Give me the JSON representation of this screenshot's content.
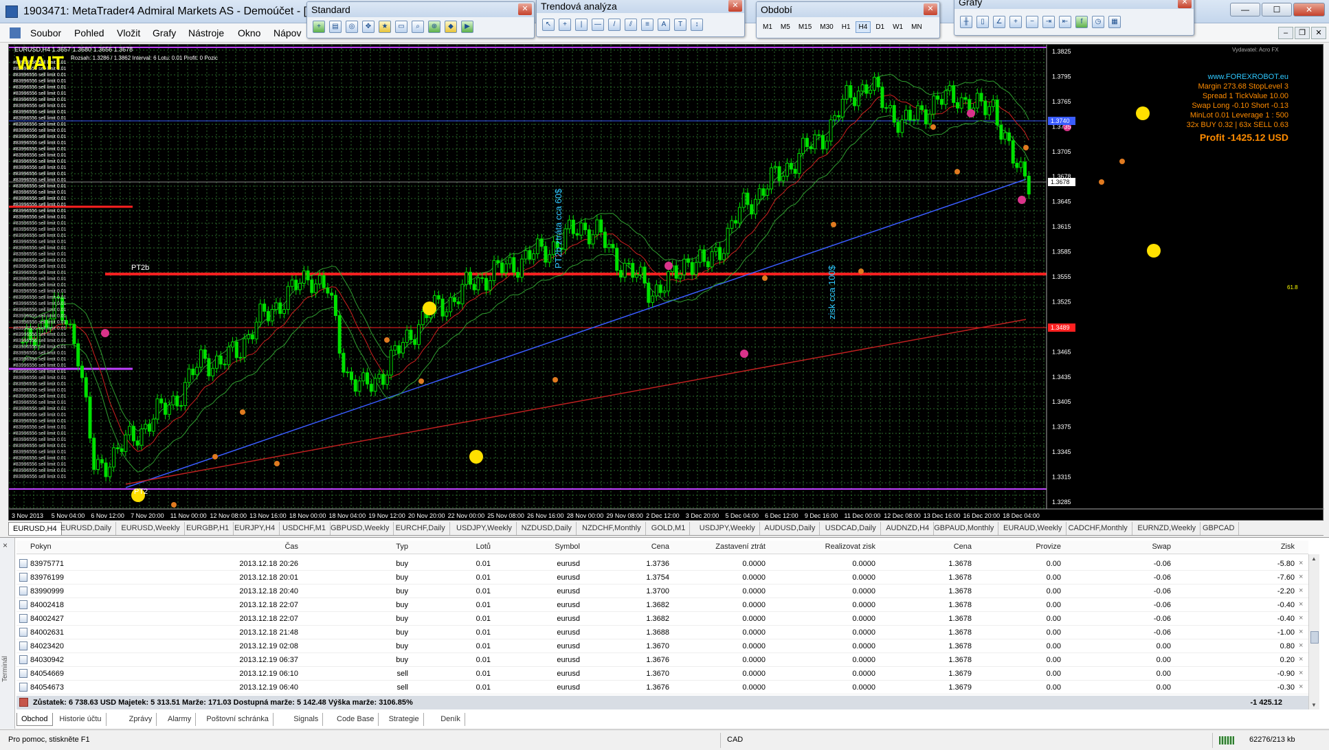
{
  "window": {
    "title": "1903471: MetaTrader4 Admiral Markets AS - Demoúčet - [EUR",
    "minimize": "—",
    "maximize": "☐",
    "close": "✕"
  },
  "menu": {
    "items": [
      "Soubor",
      "Pohled",
      "Vložit",
      "Grafy",
      "Nástroje",
      "Okno",
      "Nápov"
    ]
  },
  "toolbars": {
    "standard": {
      "title": "Standard"
    },
    "trend": {
      "title": "Trendová analýza"
    },
    "period": {
      "title": "Období",
      "buttons": [
        "M1",
        "M5",
        "M15",
        "M30",
        "H1",
        "H4",
        "D1",
        "W1",
        "MN"
      ],
      "active": "H4"
    },
    "charts": {
      "title": "Grafy"
    }
  },
  "chart": {
    "header": "EURUSD,H4  1.3657 1.3680 1.3656 1.3678",
    "wait_label": "WAIT",
    "range_info": "Rozsah: 1.3286 / 1.3862  Interval: 6  Lotu: 0.01  Profit: 0  Pozic",
    "top_right_label": "Vydavatel: Acro FX",
    "pt2b_label": "PT2b",
    "pt2_label": "PT2",
    "vertical_note_1": "PT2b  ztráta cca 60$",
    "vertical_note_2": "zisk cca 100$",
    "info_lines": [
      "www.FOREXROBOT.eu",
      "Margin 273.68  StopLevel 3",
      "Spread 1  TickValue 10.00",
      "Swap Long -0.10 Short -0.13",
      "MinLot 0.01  Leverage 1 : 500",
      "32x BUY 0.32 | 63x SELL 0.63"
    ],
    "profit_text": "Profit -1425.12 USD",
    "orders_text": "#83996556 sell limit 0.01",
    "price_labels": [
      "1.3825",
      "1.3795",
      "1.3765",
      "1.3735",
      "1.3705",
      "1.3678",
      "1.3645",
      "1.3615",
      "1.3585",
      "1.3555",
      "1.3525",
      "1.3495",
      "1.3465",
      "1.3435",
      "1.3405",
      "1.3375",
      "1.3345",
      "1.3315",
      "1.3285"
    ],
    "current_price": "1.3678",
    "blue_line_price": "1.3740",
    "red_line_price": "1.3489",
    "level_marker": "61.8",
    "time_labels": [
      "3 Nov 2013",
      "5 Nov 04:00",
      "6 Nov 12:00",
      "7 Nov 20:00",
      "11 Nov 00:00",
      "12 Nov 08:00",
      "13 Nov 16:00",
      "18 Nov 00:00",
      "18 Nov 04:00",
      "19 Nov 12:00",
      "20 Nov 20:00",
      "22 Nov 00:00",
      "25 Nov 08:00",
      "26 Nov 16:00",
      "28 Nov 00:00",
      "29 Nov 08:00",
      "2 Dec 12:00",
      "3 Dec 20:00",
      "5 Dec 04:00",
      "6 Dec 12:00",
      "9 Dec 16:00",
      "11 Dec 00:00",
      "12 Dec 08:00",
      "13 Dec 16:00",
      "16 Dec 20:00",
      "18 Dec 04:00"
    ],
    "colors": {
      "background": "#000000",
      "grid": "#2c6b2c",
      "candle": "#00e000",
      "red": "#ff2020",
      "blue": "#3a5cff",
      "purple": "#c040ff"
    }
  },
  "chart_data": {
    "type": "candlestick",
    "symbol": "EURUSD",
    "timeframe": "H4",
    "ylim": [
      1.3275,
      1.3835
    ],
    "close_path": [
      1.347,
      1.35,
      1.352,
      1.348,
      1.332,
      1.334,
      1.336,
      1.338,
      1.34,
      1.342,
      1.346,
      1.345,
      1.347,
      1.35,
      1.352,
      1.354,
      1.356,
      1.354,
      1.344,
      1.342,
      1.344,
      1.347,
      1.35,
      1.352,
      1.353,
      1.355,
      1.356,
      1.357,
      1.358,
      1.359,
      1.36,
      1.362,
      1.361,
      1.358,
      1.356,
      1.354,
      1.355,
      1.358,
      1.357,
      1.36,
      1.364,
      1.366,
      1.368,
      1.37,
      1.372,
      1.374,
      1.378,
      1.379,
      1.377,
      1.374,
      1.376,
      1.377,
      1.378,
      1.376,
      1.377,
      1.37,
      1.3678
    ]
  },
  "symbol_tabs": [
    "EURUSD,H4",
    "EURUSD,Daily",
    "EURUSD,Weekly",
    "EURGBP,H1",
    "EURJPY,H4",
    "USDCHF,M1",
    "GBPUSD,Weekly",
    "EURCHF,Daily",
    "USDJPY,Weekly",
    "NZDUSD,Daily",
    "NZDCHF,Monthly",
    "GOLD,M1",
    "USDJPY,Weekly",
    "AUDUSD,Daily",
    "USDCAD,Daily",
    "AUDNZD,H4",
    "GBPAUD,Monthly",
    "EURAUD,Weekly",
    "CADCHF,Monthly",
    "EURNZD,Weekly",
    "GBPCAD"
  ],
  "terminal": {
    "side_label": "Terminál",
    "side_close": "×",
    "columns": [
      "Pokyn",
      "Čas",
      "Typ",
      "Lotů",
      "Symbol",
      "Cena",
      "Zastavení ztrát",
      "Realizovat zisk",
      "Cena",
      "Provize",
      "Swap",
      "Zisk"
    ],
    "rows": [
      {
        "id": "83975771",
        "time": "2013.12.18 20:26",
        "type": "buy",
        "lots": "0.01",
        "symbol": "eurusd",
        "price": "1.3736",
        "sl": "0.0000",
        "tp": "0.0000",
        "cur": "1.3678",
        "comm": "0.00",
        "swap": "-0.06",
        "profit": "-5.80"
      },
      {
        "id": "83976199",
        "time": "2013.12.18 20:01",
        "type": "buy",
        "lots": "0.01",
        "symbol": "eurusd",
        "price": "1.3754",
        "sl": "0.0000",
        "tp": "0.0000",
        "cur": "1.3678",
        "comm": "0.00",
        "swap": "-0.06",
        "profit": "-7.60"
      },
      {
        "id": "83990999",
        "time": "2013.12.18 20:40",
        "type": "buy",
        "lots": "0.01",
        "symbol": "eurusd",
        "price": "1.3700",
        "sl": "0.0000",
        "tp": "0.0000",
        "cur": "1.3678",
        "comm": "0.00",
        "swap": "-0.06",
        "profit": "-2.20"
      },
      {
        "id": "84002418",
        "time": "2013.12.18 22:07",
        "type": "buy",
        "lots": "0.01",
        "symbol": "eurusd",
        "price": "1.3682",
        "sl": "0.0000",
        "tp": "0.0000",
        "cur": "1.3678",
        "comm": "0.00",
        "swap": "-0.06",
        "profit": "-0.40"
      },
      {
        "id": "84002427",
        "time": "2013.12.18 22:07",
        "type": "buy",
        "lots": "0.01",
        "symbol": "eurusd",
        "price": "1.3682",
        "sl": "0.0000",
        "tp": "0.0000",
        "cur": "1.3678",
        "comm": "0.00",
        "swap": "-0.06",
        "profit": "-0.40"
      },
      {
        "id": "84002631",
        "time": "2013.12.18 21:48",
        "type": "buy",
        "lots": "0.01",
        "symbol": "eurusd",
        "price": "1.3688",
        "sl": "0.0000",
        "tp": "0.0000",
        "cur": "1.3678",
        "comm": "0.00",
        "swap": "-0.06",
        "profit": "-1.00"
      },
      {
        "id": "84023420",
        "time": "2013.12.19 02:08",
        "type": "buy",
        "lots": "0.01",
        "symbol": "eurusd",
        "price": "1.3670",
        "sl": "0.0000",
        "tp": "0.0000",
        "cur": "1.3678",
        "comm": "0.00",
        "swap": "0.00",
        "profit": "0.80"
      },
      {
        "id": "84030942",
        "time": "2013.12.19 06:37",
        "type": "buy",
        "lots": "0.01",
        "symbol": "eurusd",
        "price": "1.3676",
        "sl": "0.0000",
        "tp": "0.0000",
        "cur": "1.3678",
        "comm": "0.00",
        "swap": "0.00",
        "profit": "0.20"
      },
      {
        "id": "84054669",
        "time": "2013.12.19 06:10",
        "type": "sell",
        "lots": "0.01",
        "symbol": "eurusd",
        "price": "1.3670",
        "sl": "0.0000",
        "tp": "0.0000",
        "cur": "1.3679",
        "comm": "0.00",
        "swap": "0.00",
        "profit": "-0.90"
      },
      {
        "id": "84054673",
        "time": "2013.12.19 06:40",
        "type": "sell",
        "lots": "0.01",
        "symbol": "eurusd",
        "price": "1.3676",
        "sl": "0.0000",
        "tp": "0.0000",
        "cur": "1.3679",
        "comm": "0.00",
        "swap": "0.00",
        "profit": "-0.30"
      }
    ],
    "summary": "Zůstatek: 6 738.63 USD  Majetek: 5 313.51  Marže: 171.03  Dostupná marže: 5 142.48  Výška marže: 3106.85%",
    "summary_profit": "-1 425.12",
    "tabs": [
      "Obchod",
      "Historie účtu",
      "Zprávy",
      "Alarmy",
      "Poštovní schránka",
      "Signals",
      "Code Base",
      "Strategie",
      "Deník"
    ],
    "active_tab": "Obchod"
  },
  "status": {
    "help": "Pro pomoc, stiskněte F1",
    "profile": "CAD",
    "traffic": "62276/213 kb"
  }
}
